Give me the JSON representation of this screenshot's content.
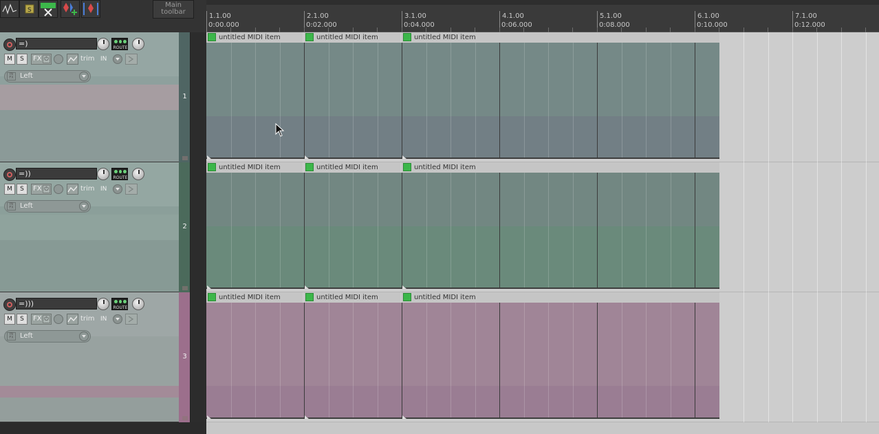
{
  "toolbar": {
    "main_toolbar_label": "Main\ntoolbar",
    "buttons": [
      {
        "name": "envelope-tool-icon"
      },
      {
        "name": "snap-icon"
      },
      {
        "name": "split-scissors-icon"
      },
      {
        "name": "add-marker-icon"
      },
      {
        "name": "add-region-icon"
      }
    ]
  },
  "ruler": {
    "marks": [
      {
        "bar": "1.1.00",
        "time": "0:00.000"
      },
      {
        "bar": "2.1.00",
        "time": "0:02.000"
      },
      {
        "bar": "3.1.00",
        "time": "0:04.000"
      },
      {
        "bar": "4.1.00",
        "time": "0:06.000"
      },
      {
        "bar": "5.1.00",
        "time": "0:08.000"
      },
      {
        "bar": "6.1.00",
        "time": "0:10.000"
      },
      {
        "bar": "7.1.00",
        "time": "0:12.000"
      }
    ]
  },
  "tracks": [
    {
      "number": "1",
      "name": "=)",
      "mute": "M",
      "solo": "S",
      "fx": "FX",
      "trim": "trim",
      "input": "IN",
      "route": "ROUTE",
      "io": "Left",
      "color": "#7a8c8b"
    },
    {
      "number": "2",
      "name": "=))",
      "mute": "M",
      "solo": "S",
      "fx": "FX",
      "trim": "trim",
      "input": "IN",
      "route": "ROUTE",
      "io": "Left",
      "color": "#6d8a7e"
    },
    {
      "number": "3",
      "name": "=)))",
      "mute": "M",
      "solo": "S",
      "fx": "FX",
      "trim": "trim",
      "input": "IN",
      "route": "ROUTE",
      "io": "Left",
      "color": "#a5849a"
    }
  ],
  "items": {
    "label": "untitled MIDI item"
  }
}
